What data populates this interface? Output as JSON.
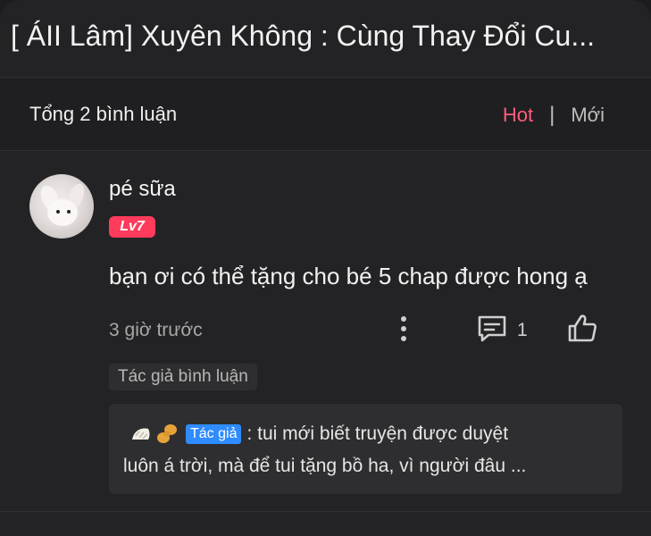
{
  "header": {
    "title": "[ ÁII Lâm] Xuyên Không : Cùng Thay Đổi Cu..."
  },
  "summary": {
    "total_label": "Tổng 2 bình luận",
    "sort_hot": "Hot",
    "sort_separator": "|",
    "sort_new": "Mới"
  },
  "comment": {
    "username": "pé sữa",
    "level": "Lv7",
    "text": "bạn ơi có thể tặng cho bé 5 chap được hong ạ",
    "time": "3 giờ trước",
    "reply_count": "1",
    "author_tag": "Tác giả bình luận"
  },
  "reply": {
    "badge": "Tác giả",
    "text_line1": ": tui mới biết truyện được duyệt",
    "text_line2": "luôn á trời,  mà để tui tặng bồ ha, vì người đâu ..."
  },
  "icons": {
    "more": "more-vertical-icon",
    "reply": "comment-icon",
    "like": "thumbs-up-icon",
    "avatar": "bunny-avatar"
  },
  "colors": {
    "accent": "#ff5c7a",
    "level_badge": "#ff3b5c",
    "author_badge": "#2f8cff"
  }
}
